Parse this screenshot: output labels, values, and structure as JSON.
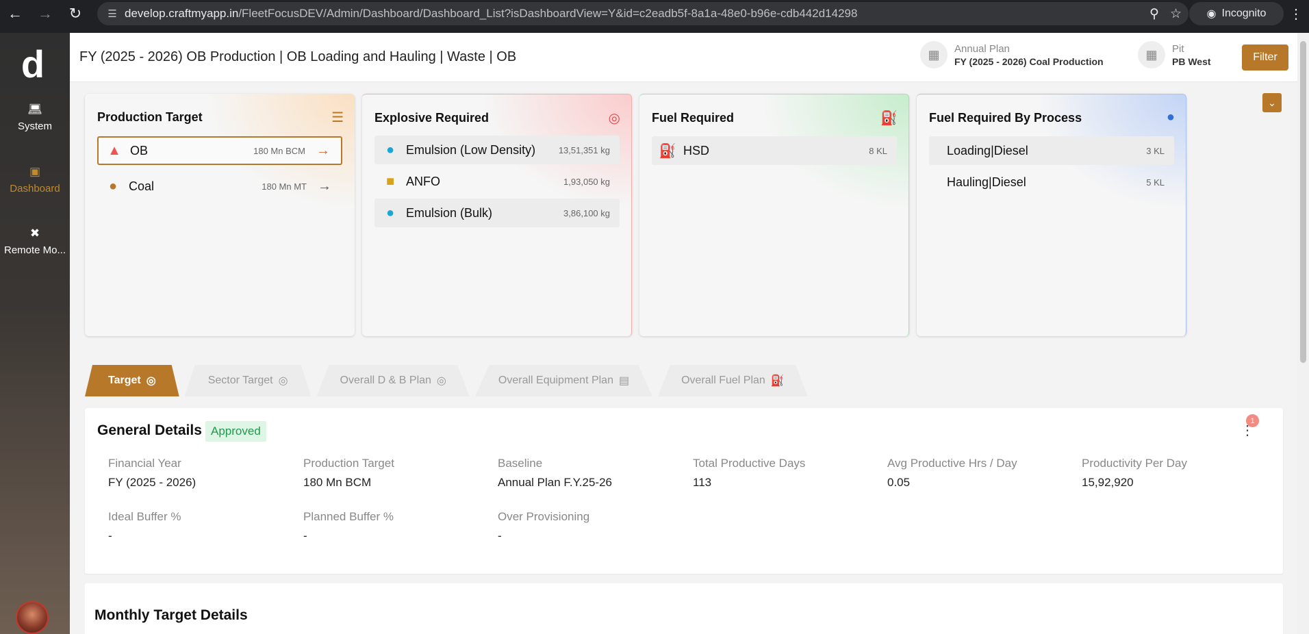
{
  "browser": {
    "url_host": "develop.craftmyapp.in",
    "url_path": "/FleetFocusDEV/Admin/Dashboard/Dashboard_List?isDashboardView=Y&id=c2eadb5f-8a1a-48e0-b96e-cdb442d14298",
    "incognito_label": "Incognito",
    "icons": [
      "back-arrow-icon",
      "forward-arrow-icon",
      "reload-icon",
      "site-info-icon",
      "zoom-icon",
      "bookmark-star-icon",
      "incognito-icon",
      "more-vertical-icon"
    ]
  },
  "sidebar": {
    "logo": "d",
    "items": [
      {
        "label": "System",
        "icon": "laptop-icon",
        "active": false
      },
      {
        "label": "Dashboard",
        "icon": "dashboard-icon",
        "active": true
      },
      {
        "label": "Remote Mo...",
        "icon": "remote-icon",
        "active": false
      }
    ]
  },
  "header": {
    "title": "FY (2025 - 2026) OB Production | OB Loading and Hauling | Waste | OB",
    "annual_plan_label": "Annual Plan",
    "annual_plan_value": "FY (2025 - 2026) Coal Production",
    "pit_label": "Pit",
    "pit_value": "PB West",
    "filter_label": "Filter"
  },
  "cards": {
    "production_target": {
      "title": "Production Target",
      "rows": [
        {
          "label": "OB",
          "value": "180 Mn BCM",
          "selected": true
        },
        {
          "label": "Coal",
          "value": "180 Mn MT",
          "selected": false
        }
      ]
    },
    "explosive_required": {
      "title": "Explosive Required",
      "rows": [
        {
          "label": "Emulsion (Low Density)",
          "value": "13,51,351 kg"
        },
        {
          "label": "ANFO",
          "value": "1,93,050 kg"
        },
        {
          "label": "Emulsion (Bulk)",
          "value": "3,86,100 kg"
        }
      ]
    },
    "fuel_required": {
      "title": "Fuel Required",
      "rows": [
        {
          "label": "HSD",
          "value": "8 KL"
        }
      ]
    },
    "fuel_by_process": {
      "title": "Fuel Required By Process",
      "rows": [
        {
          "label": "Loading|Diesel",
          "value": "3 KL"
        },
        {
          "label": "Hauling|Diesel",
          "value": "5 KL"
        }
      ]
    }
  },
  "tabs": [
    {
      "label": "Target",
      "active": true
    },
    {
      "label": "Sector Target",
      "active": false
    },
    {
      "label": "Overall D & B Plan",
      "active": false
    },
    {
      "label": "Overall Equipment Plan",
      "active": false
    },
    {
      "label": "Overall Fuel Plan",
      "active": false
    }
  ],
  "general_details": {
    "title": "General Details",
    "status": "Approved",
    "notification_count": "1",
    "fields": [
      {
        "label": "Financial Year",
        "value": "FY (2025 - 2026)"
      },
      {
        "label": "Production Target",
        "value": "180 Mn BCM"
      },
      {
        "label": "Baseline",
        "value": "Annual Plan F.Y.25-26"
      },
      {
        "label": "Total Productive Days",
        "value": "113"
      },
      {
        "label": "Avg Productive Hrs / Day",
        "value": "0.05"
      },
      {
        "label": "Productivity Per Day",
        "value": "15,92,920"
      },
      {
        "label": "Ideal Buffer %",
        "value": "-"
      },
      {
        "label": "Planned Buffer %",
        "value": "-"
      },
      {
        "label": "Over Provisioning",
        "value": "-"
      }
    ]
  },
  "monthly": {
    "title": "Monthly Target Details"
  },
  "colors": {
    "accent": "#b8782a",
    "approved_bg": "#dff5e6",
    "approved_text": "#1e9a4a"
  }
}
